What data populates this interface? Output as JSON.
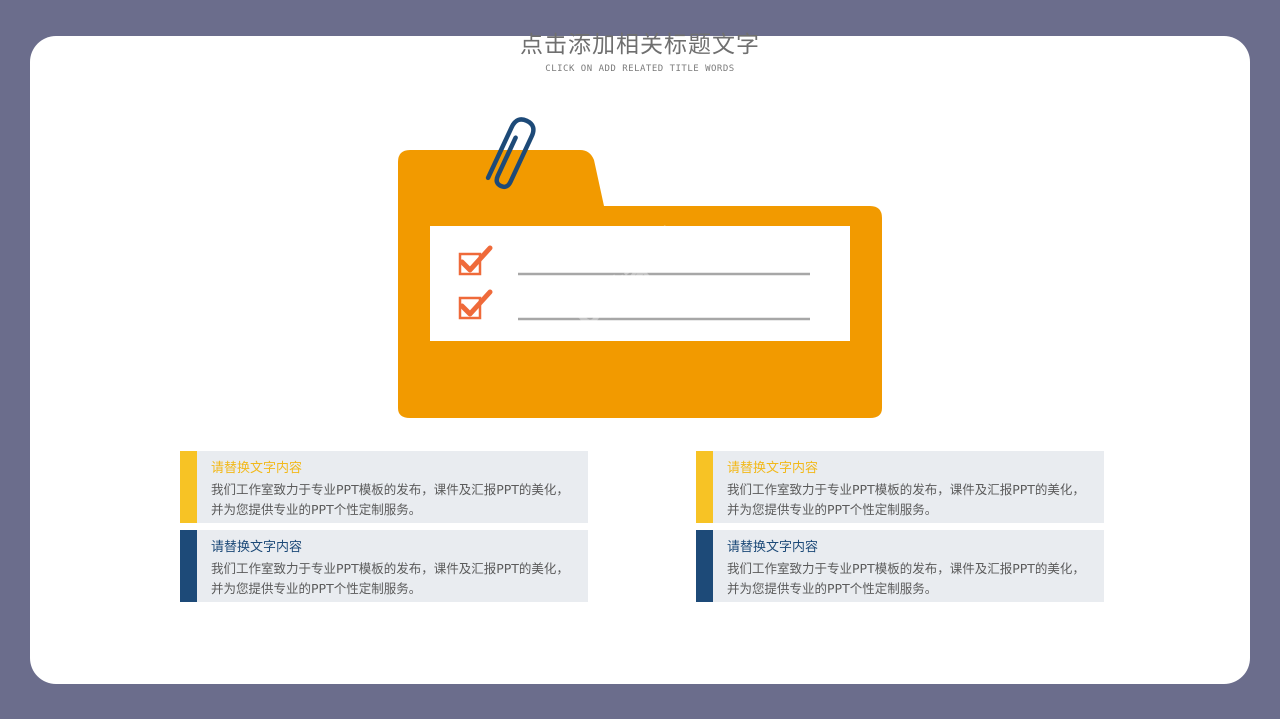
{
  "header": {
    "title": "点击添加相关标题文字",
    "subtitle": "CLICK ON ADD RELATED TITLE WORDS"
  },
  "colors": {
    "background": "#6b6d8c",
    "folder": "#f29a00",
    "check": "#ef6a3a",
    "clip": "#1d4a78",
    "accent_yellow": "#f7c325",
    "accent_navy": "#1d4a78"
  },
  "illustration": {
    "icons": [
      "paperclip-icon",
      "checkbox-checked-icon",
      "checkbox-checked-icon"
    ],
    "watermark": "ppt素材"
  },
  "cards": [
    {
      "heading": "请替换文字内容",
      "text": "我们工作室致力于专业PPT模板的发布，课件及汇报PPT的美化，并为您提供专业的PPT个性定制服务。"
    },
    {
      "heading": "请替换文字内容",
      "text": "我们工作室致力于专业PPT模板的发布，课件及汇报PPT的美化，并为您提供专业的PPT个性定制服务。"
    },
    {
      "heading": "请替换文字内容",
      "text": "我们工作室致力于专业PPT模板的发布，课件及汇报PPT的美化，并为您提供专业的PPT个性定制服务。"
    },
    {
      "heading": "请替换文字内容",
      "text": "我们工作室致力于专业PPT模板的发布，课件及汇报PPT的美化，并为您提供专业的PPT个性定制服务。"
    }
  ]
}
